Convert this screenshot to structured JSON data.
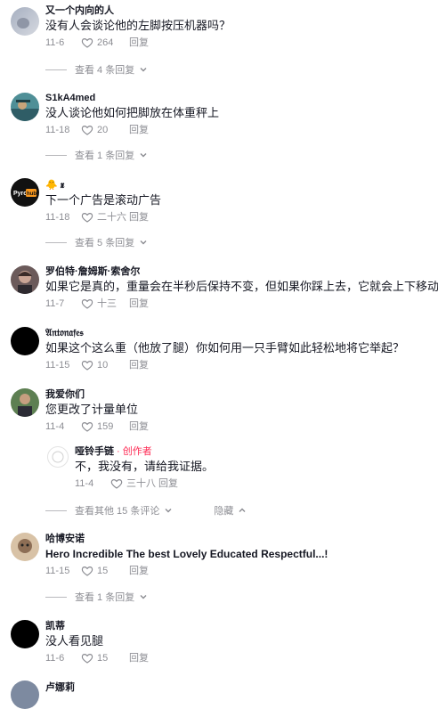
{
  "reply_label": "回复",
  "comments": [
    {
      "username": "又一个内向的人",
      "text": "没有人会谈论他的左脚按压机器吗？",
      "date": "11-6",
      "likes": "264",
      "view_replies": "查看 4 条回复"
    },
    {
      "username": "S1kA4med",
      "text": "没人谈论他如何把脚放在体重秤上",
      "date": "11-18",
      "likes": "20",
      "view_replies": "查看 1 条回复"
    },
    {
      "username": "🐥 𝖝",
      "text": "下一个广告是滚动广告",
      "date": "11-18",
      "likes": "二十六",
      "view_replies": "查看 5 条回复"
    },
    {
      "username": "罗伯特·詹姆斯·索舍尔",
      "text": "如果它是真的，重量会在半秒后保持不变，但如果你踩上去，它就会上下移动",
      "date": "11-7",
      "likes": "十三"
    },
    {
      "username": "𝔄𝔫𝔱𝔬𝔫𝔞𝔣𝔢𝔰",
      "text": "如果这个这么重（他放了腿）你如何用一只手臂如此轻松地将它举起？",
      "date": "11-15",
      "likes": "10"
    },
    {
      "username": "我爱你们",
      "text": "您更改了计量单位",
      "date": "11-4",
      "likes": "159",
      "reply": {
        "username": "哑铃手链",
        "creator_tag": " · 创作者",
        "text": "不，我没有，请给我证据。",
        "date": "11-4",
        "likes": "三十八"
      },
      "view_replies": "查看其他 15 条评论",
      "hide_label": "隐藏"
    },
    {
      "username": "哈博安诺",
      "text": "Hero Incredible The best Lovely Educated Respectful...!",
      "date": "11-15",
      "likes": "15",
      "view_replies": "查看 1 条回复"
    },
    {
      "username": "凯蒂",
      "text": "没人看见腿",
      "date": "11-6",
      "likes": "15"
    },
    {
      "username": "卢娜莉"
    }
  ]
}
